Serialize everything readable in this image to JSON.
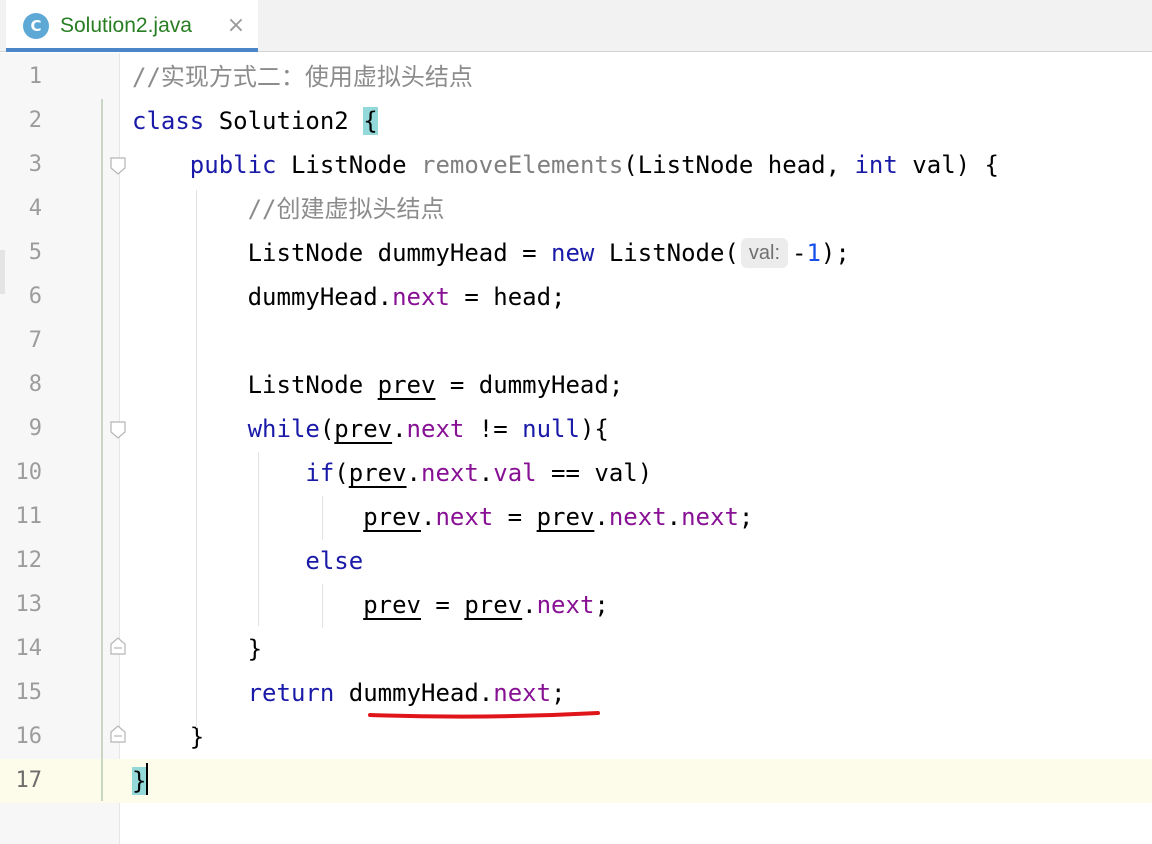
{
  "tab": {
    "icon_letter": "C",
    "title": "Solution2.java",
    "close_glyph": "×"
  },
  "lines": [
    {
      "no": "1",
      "tokens": [
        {
          "t": "//实现方式二：使用虚拟头结点",
          "c": "cm"
        }
      ]
    },
    {
      "no": "2",
      "tokens": [
        {
          "t": "class",
          "c": "kw"
        },
        {
          "t": " Solution2 "
        },
        {
          "t": "{",
          "c": "brace-hl"
        }
      ]
    },
    {
      "no": "3",
      "tokens": [
        {
          "t": "    "
        },
        {
          "t": "public",
          "c": "kw"
        },
        {
          "t": " ListNode "
        },
        {
          "t": "removeElements",
          "c": "fn"
        },
        {
          "t": "(ListNode head, "
        },
        {
          "t": "int",
          "c": "kw"
        },
        {
          "t": " val) {"
        }
      ]
    },
    {
      "no": "4",
      "tokens": [
        {
          "t": "        "
        },
        {
          "t": "//创建虚拟头结点",
          "c": "cm"
        }
      ]
    },
    {
      "no": "5",
      "tokens": [
        {
          "t": "        ListNode dummyHead = "
        },
        {
          "t": "new",
          "c": "kw"
        },
        {
          "t": " ListNode("
        },
        {
          "t": "val:",
          "c": "hint"
        },
        {
          "t": "-"
        },
        {
          "t": "1",
          "c": "num"
        },
        {
          "t": ");"
        }
      ]
    },
    {
      "no": "6",
      "tokens": [
        {
          "t": "        dummyHead."
        },
        {
          "t": "next",
          "c": "fld"
        },
        {
          "t": " = head;"
        }
      ]
    },
    {
      "no": "7",
      "tokens": []
    },
    {
      "no": "8",
      "tokens": [
        {
          "t": "        ListNode "
        },
        {
          "t": "prev",
          "c": "ul"
        },
        {
          "t": " = dummyHead;"
        }
      ]
    },
    {
      "no": "9",
      "tokens": [
        {
          "t": "        "
        },
        {
          "t": "while",
          "c": "kw"
        },
        {
          "t": "("
        },
        {
          "t": "prev",
          "c": "ul"
        },
        {
          "t": "."
        },
        {
          "t": "next",
          "c": "fld"
        },
        {
          "t": " != "
        },
        {
          "t": "null",
          "c": "kw"
        },
        {
          "t": "){"
        }
      ]
    },
    {
      "no": "10",
      "tokens": [
        {
          "t": "            "
        },
        {
          "t": "if",
          "c": "kw"
        },
        {
          "t": "("
        },
        {
          "t": "prev",
          "c": "ul"
        },
        {
          "t": "."
        },
        {
          "t": "next",
          "c": "fld"
        },
        {
          "t": "."
        },
        {
          "t": "val",
          "c": "fld"
        },
        {
          "t": " == val)"
        }
      ]
    },
    {
      "no": "11",
      "tokens": [
        {
          "t": "                "
        },
        {
          "t": "prev",
          "c": "ul"
        },
        {
          "t": "."
        },
        {
          "t": "next",
          "c": "fld"
        },
        {
          "t": " = "
        },
        {
          "t": "prev",
          "c": "ul"
        },
        {
          "t": "."
        },
        {
          "t": "next",
          "c": "fld"
        },
        {
          "t": "."
        },
        {
          "t": "next",
          "c": "fld"
        },
        {
          "t": ";"
        }
      ]
    },
    {
      "no": "12",
      "tokens": [
        {
          "t": "            "
        },
        {
          "t": "else",
          "c": "kw"
        }
      ]
    },
    {
      "no": "13",
      "tokens": [
        {
          "t": "                "
        },
        {
          "t": "prev",
          "c": "ul"
        },
        {
          "t": " = "
        },
        {
          "t": "prev",
          "c": "ul"
        },
        {
          "t": "."
        },
        {
          "t": "next",
          "c": "fld"
        },
        {
          "t": ";"
        }
      ]
    },
    {
      "no": "14",
      "tokens": [
        {
          "t": "        }"
        }
      ]
    },
    {
      "no": "15",
      "tokens": [
        {
          "t": "        "
        },
        {
          "t": "return",
          "c": "kw"
        },
        {
          "t": " dummyHead."
        },
        {
          "t": "next",
          "c": "fld"
        },
        {
          "t": ";"
        }
      ]
    },
    {
      "no": "16",
      "tokens": [
        {
          "t": "    }"
        }
      ]
    },
    {
      "no": "17",
      "current": true,
      "tokens": [
        {
          "t": "}",
          "c": "brace-hl"
        },
        {
          "caret": true
        }
      ]
    }
  ],
  "colors": {
    "keyword": "#1a1aa8",
    "comment": "#8c8c8c",
    "field": "#871094",
    "number": "#1750eb",
    "annotation_mark": "#e0151a"
  }
}
